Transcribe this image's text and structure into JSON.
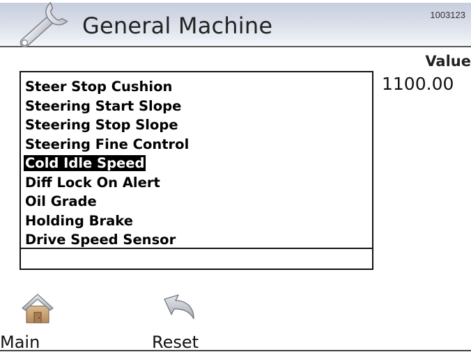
{
  "header": {
    "title": "General Machine",
    "doc_id": "1003123",
    "icon": "wrench-icon"
  },
  "value_panel": {
    "label": "Value",
    "amount": "1100.00"
  },
  "parameter_list": {
    "items": [
      {
        "label": "Steer Stop Cushion",
        "selected": false
      },
      {
        "label": "Steering Start Slope",
        "selected": false
      },
      {
        "label": "Steering Stop Slope",
        "selected": false
      },
      {
        "label": "Steering Fine Control",
        "selected": false
      },
      {
        "label": "Cold Idle Speed",
        "selected": true
      },
      {
        "label": "Diff Lock On Alert",
        "selected": false
      },
      {
        "label": "Oil Grade",
        "selected": false
      },
      {
        "label": "Holding Brake",
        "selected": false
      },
      {
        "label": "Drive Speed Sensor",
        "selected": false
      }
    ],
    "selected_index": 4
  },
  "footer": {
    "main": {
      "label": "Main",
      "icon": "home-icon"
    },
    "reset": {
      "label": "Reset",
      "icon": "undo-arrow-icon"
    }
  },
  "colors": {
    "selection_bg": "#000000",
    "selection_fg": "#ffffff",
    "header_gradient_top": "#c6cddc",
    "house_color": "#c8a47a"
  }
}
